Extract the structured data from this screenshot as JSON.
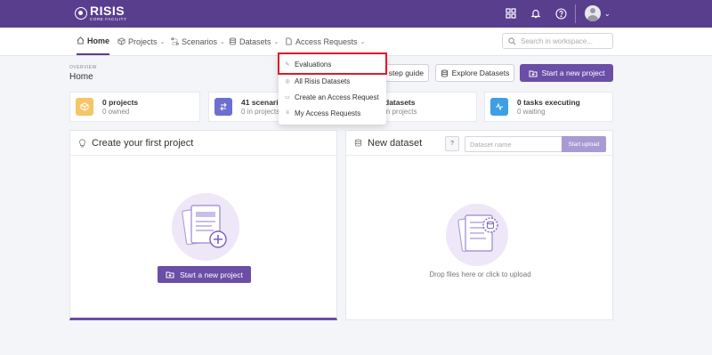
{
  "topbar": {
    "logo_name": "RISIS",
    "logo_sub": "CORE FACILITY"
  },
  "nav": {
    "items": [
      {
        "label": "Home"
      },
      {
        "label": "Projects"
      },
      {
        "label": "Scenarios"
      },
      {
        "label": "Datasets"
      },
      {
        "label": "Access Requests"
      }
    ],
    "search_placeholder": "Search in workspace..."
  },
  "header": {
    "overview_label": "OVERVIEW",
    "title": "Home",
    "guide_label": "step guide",
    "explore_label": "Explore Datasets",
    "start_label": "Start a new project"
  },
  "stats": [
    {
      "main": "0 projects",
      "sub": "0 owned",
      "color": "#f5c567"
    },
    {
      "main": "41 scenarios",
      "sub": "0 in projects",
      "color": "#6b6fd0"
    },
    {
      "main": "datasets",
      "sub": "in projects",
      "color": "#4a9de0"
    },
    {
      "main": "0 tasks executing",
      "sub": "0 waiting",
      "color": "#3d9fe5"
    }
  ],
  "project_panel": {
    "title": "Create your first project",
    "button_label": "Start a new project"
  },
  "dataset_panel": {
    "title": "New dataset",
    "help_label": "?",
    "name_placeholder": "Dataset name",
    "upload_label": "Start upload",
    "drop_text": "Drop files here or click to upload"
  },
  "dropdown": {
    "items": [
      {
        "label": "Evaluations"
      },
      {
        "label": "All Risis Datasets"
      },
      {
        "label": "Create an Access Request"
      },
      {
        "label": "My Access Requests"
      }
    ],
    "highlight_color": "#e0192b"
  },
  "colors": {
    "brand": "#5a3e8e",
    "accent": "#6b4ea6"
  }
}
